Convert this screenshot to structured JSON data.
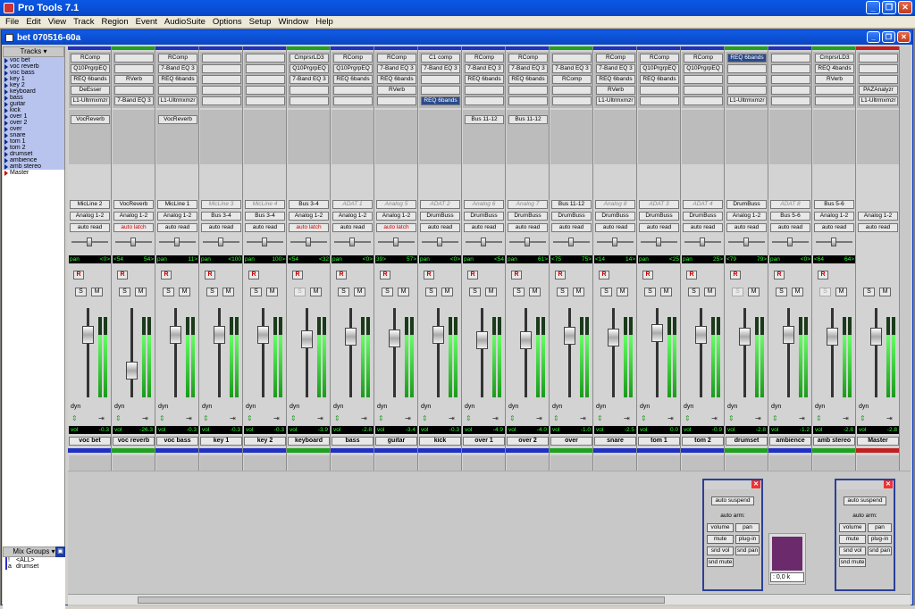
{
  "app": {
    "title": "Pro Tools 7.1"
  },
  "menu": [
    "File",
    "Edit",
    "View",
    "Track",
    "Region",
    "Event",
    "AudioSuite",
    "Options",
    "Setup",
    "Window",
    "Help"
  ],
  "document": {
    "title": "bet 070516-60a"
  },
  "sidebar": {
    "tracks_header": "Tracks",
    "tracks": [
      "voc bet",
      "voc reverb",
      "voc bass",
      "key 1",
      "key 2",
      "keyboard",
      "bass",
      "guitar",
      "kick",
      "over 1",
      "over 2",
      "over",
      "snare",
      "tom 1",
      "tom 2",
      "drumset",
      "ambience",
      "amb stereo",
      "Master"
    ],
    "mixgroups_header": "Mix Groups",
    "groups": [
      {
        "id": "!",
        "name": "<ALL>"
      },
      {
        "id": "a",
        "name": "drumset"
      }
    ]
  },
  "strips": [
    {
      "name": "voc bet",
      "color": "#2030c0",
      "inserts": [
        "RComp",
        "Q10PrgrpEQ",
        "REQ 6bands",
        "DeEsser",
        "L1-Ultrmxmzr"
      ],
      "send": "VocReverb",
      "input": "MicLine 2",
      "output": "Analog 1-2",
      "auto": "auto read",
      "pan_l": "pan",
      "pan_r": "<0>",
      "vol": "-0.3",
      "fader": 30
    },
    {
      "name": "voc reverb",
      "color": "#20a020",
      "inserts": [
        "",
        "",
        "RVerb",
        "",
        "7-Band EQ 3"
      ],
      "send": "",
      "input": "VocReverb",
      "output": "Analog 1-2",
      "auto": "auto latch",
      "pan_l": "<54",
      "pan_r": "54>",
      "vol": "-26.3",
      "fader": 70
    },
    {
      "name": "voc bass",
      "color": "#2030c0",
      "inserts": [
        "RComp",
        "7-Band EQ 3",
        "REQ 6bands",
        "",
        "L1-Ultrmxmzr"
      ],
      "send": "VocReverb",
      "input": "MicLine 1",
      "output": "Analog 1-2",
      "auto": "auto read",
      "pan_l": "pan",
      "pan_r": "11>",
      "vol": "-0.3",
      "fader": 30
    },
    {
      "name": "key 1",
      "color": "#2030c0",
      "inserts": [
        "",
        "",
        "",
        "",
        ""
      ],
      "send": "",
      "input": "MicLine 3",
      "output": "Bus 3-4",
      "auto": "auto read",
      "pan_l": "pan",
      "pan_r": "<100",
      "vol": "-0.3",
      "fader": 30
    },
    {
      "name": "key 2",
      "color": "#2030c0",
      "inserts": [
        "",
        "",
        "",
        "",
        ""
      ],
      "send": "",
      "input": "MicLine 4",
      "output": "Bus 3-4",
      "auto": "auto read",
      "pan_l": "pan",
      "pan_r": "100>",
      "vol": "-0.3",
      "fader": 30
    },
    {
      "name": "keyboard",
      "color": "#20a020",
      "inserts": [
        "CmprsrLD3",
        "Q10PrgrpEQ",
        "7-Band EQ 3",
        "",
        ""
      ],
      "send": "",
      "input": "Bus 3-4",
      "output": "Analog 1-2",
      "auto": "auto latch",
      "pan_l": "<54",
      "pan_r": "<32",
      "vol": "-3.9",
      "fader": 35
    },
    {
      "name": "bass",
      "color": "#2030c0",
      "inserts": [
        "RComp",
        "Q10PrgrpEQ",
        "REQ 6bands",
        "",
        ""
      ],
      "send": "",
      "input": "ADAT 1",
      "output": "Analog 1-2",
      "auto": "auto read",
      "pan_l": "pan",
      "pan_r": "<0>",
      "vol": "-2.8",
      "fader": 32
    },
    {
      "name": "guitar",
      "color": "#2030c0",
      "inserts": [
        "RComp",
        "7-Band EQ 3",
        "REQ 6bands",
        "RVerb",
        ""
      ],
      "send": "",
      "input": "Analog 5",
      "output": "Analog 1-2",
      "auto": "auto latch",
      "pan_l": "39>",
      "pan_r": "57>",
      "vol": "-3.4",
      "fader": 34
    },
    {
      "name": "kick",
      "color": "#2030c0",
      "inserts": [
        "C1 comp",
        "7-Band EQ 3",
        "",
        "",
        "REQ 6bands"
      ],
      "send": "",
      "input": "ADAT 2",
      "output": "DrumBuss",
      "auto": "auto read",
      "pan_l": "pan",
      "pan_r": "<0>",
      "vol": "-0.3",
      "fader": 30
    },
    {
      "name": "over 1",
      "color": "#2030c0",
      "inserts": [
        "RComp",
        "7-Band EQ 3",
        "REQ 6bands",
        "",
        ""
      ],
      "send": "Bus 11-12",
      "input": "Analog 6",
      "output": "DrumBuss",
      "auto": "auto read",
      "pan_l": "pan",
      "pan_r": "<54",
      "vol": "-4.9",
      "fader": 36
    },
    {
      "name": "over 2",
      "color": "#2030c0",
      "inserts": [
        "RComp",
        "7-Band EQ 3",
        "REQ 6bands",
        "",
        ""
      ],
      "send": "Bus 11-12",
      "input": "Analog 7",
      "output": "DrumBuss",
      "auto": "auto read",
      "pan_l": "pan",
      "pan_r": "61>",
      "vol": "-4.0",
      "fader": 36
    },
    {
      "name": "over",
      "color": "#20a020",
      "inserts": [
        "",
        "7-Band EQ 3",
        "RComp",
        "",
        ""
      ],
      "send": "",
      "input": "Bus 11-12",
      "output": "DrumBuss",
      "auto": "auto read",
      "pan_l": "<75",
      "pan_r": "75>",
      "vol": "-1.0",
      "fader": 31
    },
    {
      "name": "snare",
      "color": "#2030c0",
      "inserts": [
        "RComp",
        "7-Band EQ 3",
        "REQ 6bands",
        "RVerb",
        "L1-Ultrmxmzr"
      ],
      "send": "",
      "input": "Analog 8",
      "output": "DrumBuss",
      "auto": "auto read",
      "pan_l": "<14",
      "pan_r": "14>",
      "vol": "-2.5",
      "fader": 33
    },
    {
      "name": "tom 1",
      "color": "#2030c0",
      "inserts": [
        "RComp",
        "Q10PrgrpEQ",
        "REQ 6bands",
        "",
        ""
      ],
      "send": "",
      "input": "ADAT 3",
      "output": "DrumBuss",
      "auto": "auto read",
      "pan_l": "pan",
      "pan_r": "<25",
      "vol": "0.0",
      "fader": 28
    },
    {
      "name": "tom 2",
      "color": "#2030c0",
      "inserts": [
        "RComp",
        "Q10PrgrpEQ",
        "",
        "",
        ""
      ],
      "send": "",
      "input": "ADAT 4",
      "output": "DrumBuss",
      "auto": "auto read",
      "pan_l": "pan",
      "pan_r": "25>",
      "vol": "-0.9",
      "fader": 30
    },
    {
      "name": "drumset",
      "color": "#20a020",
      "inserts": [
        "REQ 6bands",
        "",
        "",
        "",
        "L1-Ultrmxmzr"
      ],
      "send": "",
      "input": "DrumBuss",
      "output": "Analog 1-2",
      "auto": "auto read",
      "pan_l": "<79",
      "pan_r": "79>",
      "vol": "-2.8",
      "fader": 32
    },
    {
      "name": "ambience",
      "color": "#2030c0",
      "inserts": [
        "",
        "",
        "",
        "",
        ""
      ],
      "send": "",
      "input": "ADAT 8",
      "output": "Bus 5-6",
      "auto": "auto read",
      "pan_l": "pan",
      "pan_r": "<0>",
      "vol": "-1.2",
      "fader": 30
    },
    {
      "name": "amb stereo",
      "color": "#20a020",
      "inserts": [
        "CmprsrLD3",
        "REQ 4bands",
        "RVerb",
        "",
        ""
      ],
      "send": "",
      "input": "Bus 5-6",
      "output": "Analog 1-2",
      "auto": "auto read",
      "pan_l": "<64",
      "pan_r": "64>",
      "vol": "-2.8",
      "fader": 32
    },
    {
      "name": "Master",
      "color": "#c02020",
      "inserts": [
        "",
        "",
        "",
        "PAZAnalyzr",
        "L1-Ultrmxmzr"
      ],
      "send": "",
      "input": "",
      "output": "Analog 1-2",
      "auto": "auto read",
      "pan_l": "",
      "pan_r": "",
      "vol": "-2.8",
      "fader": 32
    }
  ],
  "labels": {
    "dyn": "dyn",
    "vol": "vol",
    "rec": "R",
    "solo": "S",
    "mute": "M"
  },
  "automation": {
    "suspend": "auto suspend",
    "arm_label": "auto arm:",
    "volume": "volume",
    "pan": "pan",
    "mute": "mute",
    "plugin": "plug-in",
    "snd_vol": "snd vol",
    "snd_pan": "snd pan",
    "snd_mute": "snd mute"
  },
  "minimeter": {
    "value": ": 0,0 k"
  }
}
